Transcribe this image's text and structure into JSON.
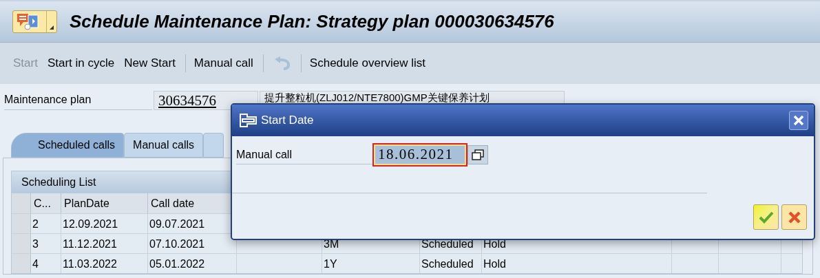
{
  "window": {
    "title": "Schedule Maintenance Plan: Strategy plan 000030634576"
  },
  "toolbar": [
    {
      "kind": "button",
      "label": "Start",
      "disabled": true
    },
    {
      "kind": "button",
      "label": "Start in cycle",
      "disabled": false
    },
    {
      "kind": "button",
      "label": "New Start",
      "disabled": false
    },
    {
      "kind": "separator"
    },
    {
      "kind": "button",
      "label": "Manual call",
      "disabled": false
    },
    {
      "kind": "separator"
    },
    {
      "kind": "undo",
      "disabled": true
    },
    {
      "kind": "separator"
    },
    {
      "kind": "button",
      "label": "Schedule overview list",
      "disabled": false
    }
  ],
  "maintenance_plan": {
    "label": "Maintenance plan",
    "value": "30634576",
    "description": "提升整粒机(ZLJ012/NTE7800)GMP关键保养计划"
  },
  "tabs": [
    {
      "label": "Scheduled calls",
      "selected": true
    },
    {
      "label": "Manual calls",
      "selected": false
    }
  ],
  "table": {
    "title": "Scheduling List",
    "columns": [
      "C...",
      "PlanDate",
      "Call date"
    ],
    "rows": [
      [
        "2",
        "12.09.2021",
        "09.07.2021"
      ],
      [
        "3",
        "11.12.2021",
        "07.10.2021",
        null,
        "3M",
        "Scheduled",
        "Hold"
      ],
      [
        "4",
        "11.03.2022",
        "05.01.2022",
        null,
        "1Y",
        "Scheduled",
        "Hold"
      ]
    ]
  },
  "dialog": {
    "title": "Start Date",
    "field_label": "Manual call",
    "field_value": "18.06.2021",
    "buttons": [
      {
        "kind": "confirm",
        "highlighted": true
      },
      {
        "kind": "cancel",
        "highlighted": false
      }
    ]
  }
}
